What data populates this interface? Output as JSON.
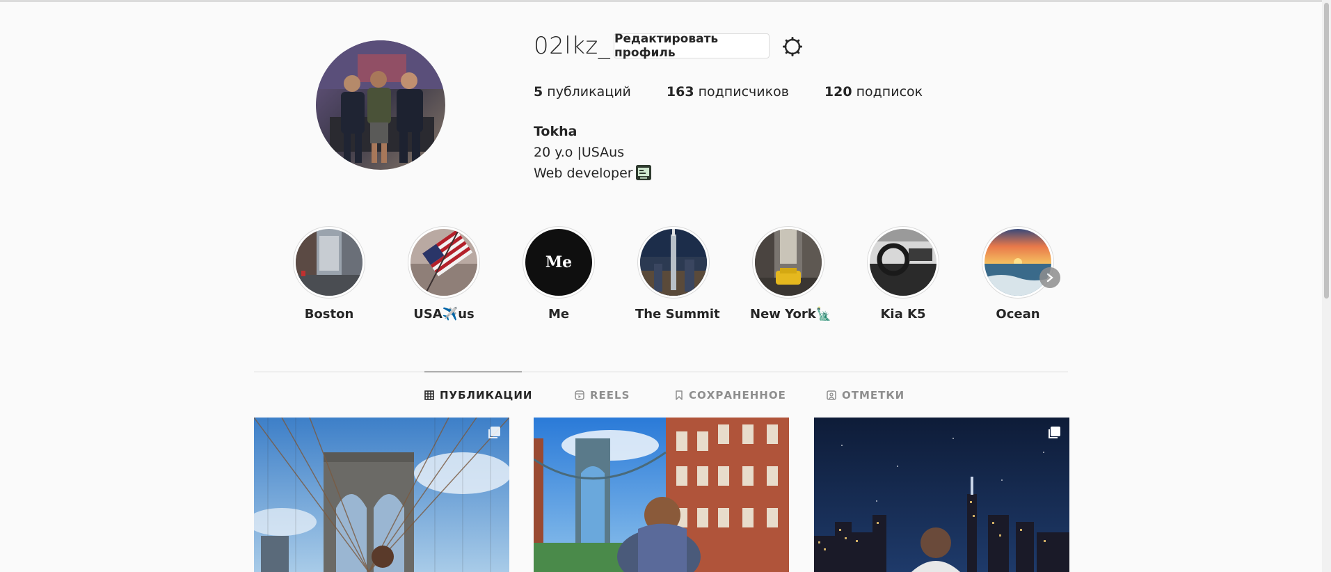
{
  "profile": {
    "username": "02lkz_",
    "edit_button_label": "Редактировать профиль",
    "stats": {
      "posts_count": "5",
      "posts_label": "публикаций",
      "followers_count": "163",
      "followers_label": "подписчиков",
      "following_count": "120",
      "following_label": "подписок"
    },
    "bio": {
      "name": "Tokha",
      "line1": "20 y.o |USAus",
      "line2": "Web developer"
    }
  },
  "highlights": [
    {
      "label": "Boston",
      "icon": "boston-street-photo"
    },
    {
      "label": "USA✈️us",
      "icon": "american-flag-photo"
    },
    {
      "label": "Me",
      "icon": "me-logo-text",
      "cover_text": "Me"
    },
    {
      "label": "The Summit",
      "icon": "skyscraper-night-photo"
    },
    {
      "label": "New York🗽",
      "icon": "taxi-street-photo"
    },
    {
      "label": "Kia K5",
      "icon": "car-interior-photo"
    },
    {
      "label": "Ocean",
      "icon": "ocean-sunset-photo"
    }
  ],
  "tabs": [
    {
      "label": "ПУБЛИКАЦИИ",
      "icon": "grid-icon",
      "active": true
    },
    {
      "label": "REELS",
      "icon": "reels-icon",
      "active": false
    },
    {
      "label": "СОХРАНЕННОЕ",
      "icon": "bookmark-icon",
      "active": false
    },
    {
      "label": "ОТМЕТКИ",
      "icon": "tagged-icon",
      "active": false
    }
  ],
  "posts": [
    {
      "subject": "brooklyn-bridge-photo",
      "multiple": true
    },
    {
      "subject": "manhattan-bridge-photo",
      "multiple": false
    },
    {
      "subject": "night-skyline-photo",
      "multiple": true
    }
  ],
  "colors": {
    "text": "#262626",
    "secondary": "#8e8e8e",
    "border": "#dbdbdb",
    "background": "#fafafa"
  }
}
